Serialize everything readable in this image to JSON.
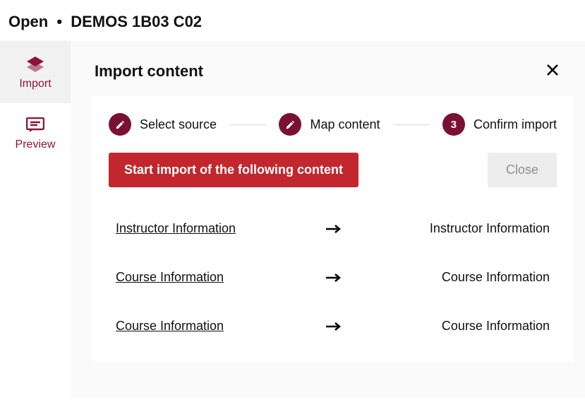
{
  "breadcrumb": {
    "status": "Open",
    "course": "DEMOS 1B03 C02"
  },
  "sidebar": {
    "items": [
      {
        "label": "Import"
      },
      {
        "label": "Preview"
      }
    ],
    "active_index": 0
  },
  "page": {
    "title": "Import content"
  },
  "stepper": {
    "steps": [
      {
        "label": "Select source",
        "badge": "pencil"
      },
      {
        "label": "Map content",
        "badge": "pencil"
      },
      {
        "label": "Confirm import",
        "badge": "3"
      }
    ],
    "current_index": 2
  },
  "actions": {
    "primary_label": "Start import of the following content",
    "secondary_label": "Close"
  },
  "mappings": [
    {
      "source": "Instructor Information",
      "target": "Instructor Information"
    },
    {
      "source": "Course Information",
      "target": "Course Information"
    },
    {
      "source": "Course Information",
      "target": "Course Information"
    }
  ],
  "colors": {
    "brand_maroon": "#7a1133",
    "primary_red": "#c1272d",
    "sidebar_text": "#8a1538"
  }
}
